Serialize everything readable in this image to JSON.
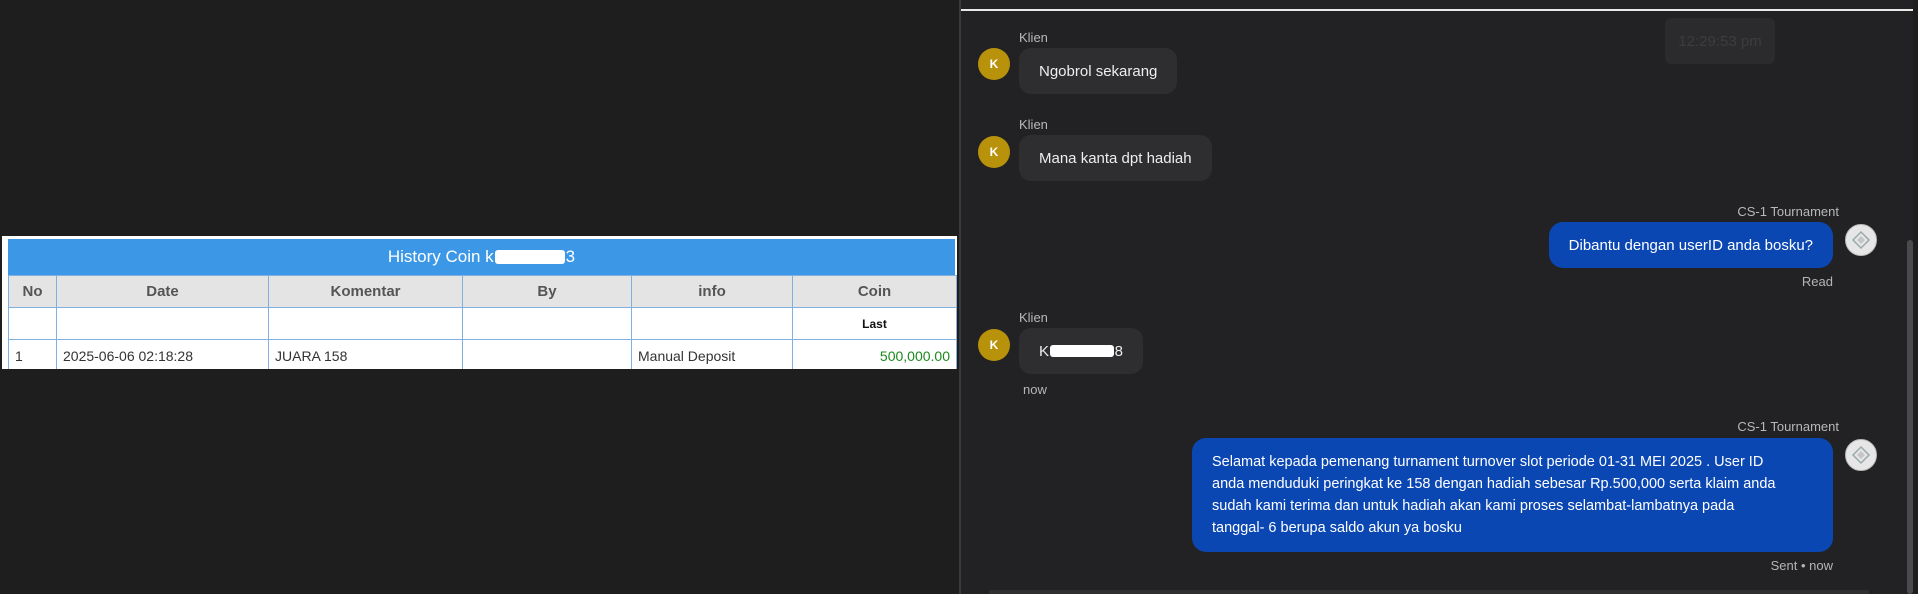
{
  "history": {
    "title": "History Coin k",
    "title_suffix": "3",
    "columns": [
      "No",
      "Date",
      "Komentar",
      "By",
      "info",
      "Coin"
    ],
    "subheader_last": "Last",
    "rows": [
      {
        "no": "1",
        "date": "2025-06-06 02:18:28",
        "komentar": "JUARA 158",
        "by": "",
        "info": "Manual Deposit",
        "coin": "500,000.00"
      }
    ]
  },
  "chat": {
    "ghost_time": "12:29:53 pm",
    "messages": [
      {
        "sender": "Klien",
        "avatar": "K",
        "text": "Ngobrol sekarang"
      },
      {
        "sender": "Klien",
        "avatar": "K",
        "text": "Mana kanta dpt hadiah"
      },
      {
        "sender": "CS-1 Tournament",
        "text": "Dibantu dengan userID anda bosku?",
        "status": "Read"
      },
      {
        "sender": "Klien",
        "avatar": "K",
        "text_prefix": "K",
        "text_suffix": "8",
        "time": "now"
      },
      {
        "sender": "CS-1 Tournament",
        "lines": [
          "Selamat kepada pemenang turnament turnover slot periode 01-31 MEI 2025 . User ID",
          "anda menduduki peringkat ke 158 dengan hadiah sebesar Rp.500,000 serta klaim anda",
          "sudah kami terima dan untuk hadiah akan kami proses selambat-lambatnya pada",
          "tanggal- 6 berupa saldo akun ya bosku"
        ],
        "status": "Sent • now"
      }
    ]
  }
}
